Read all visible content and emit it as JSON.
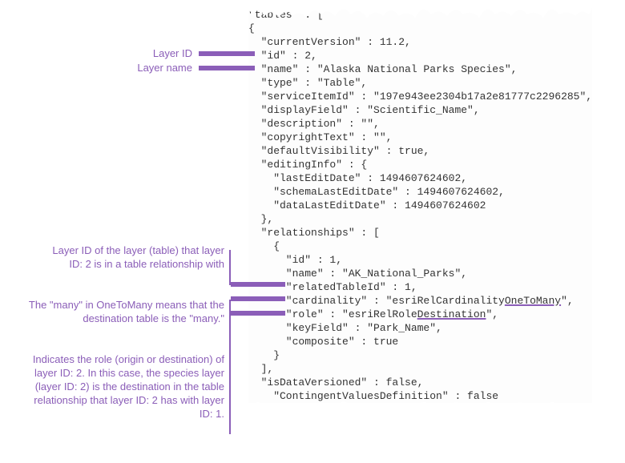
{
  "annotations": {
    "layerId": "Layer ID",
    "layerName": "Layer name",
    "relatedTable": "Layer ID of the layer (table) that layer ID: 2 is in a table relationship with",
    "onetomany": "The \"many\" in OneToMany means that the destination table is the \"many.\"",
    "role": "Indicates the role (origin or destination) of layer ID: 2. In this case, the species layer (layer ID: 2) is the destination in the table relationship that layer ID: 2 has with layer ID: 1."
  },
  "code": {
    "l1": "\"tables\" : [",
    "l2": "{",
    "l3": "  \"currentVersion\" : 11.2,",
    "l4": "  \"id\" : 2,",
    "l5": "  \"name\" : \"Alaska National Parks Species\",",
    "l6": "  \"type\" : \"Table\",",
    "l7": "  \"serviceItemId\" : \"197e943ee2304b17a2e81777c2296285\",",
    "l8": "  \"displayField\" : \"Scientific_Name\",",
    "l9": "  \"description\" : \"\",",
    "l10": "  \"copyrightText\" : \"\",",
    "l11": "  \"defaultVisibility\" : true,",
    "l12": "  \"editingInfo\" : {",
    "l13": "    \"lastEditDate\" : 1494607624602,",
    "l14": "    \"schemaLastEditDate\" : 1494607624602,",
    "l15": "    \"dataLastEditDate\" : 1494607624602",
    "l16": "  },",
    "l17": "  \"relationships\" : [",
    "l18": "    {",
    "l19": "      \"id\" : 1,",
    "l20": "      \"name\" : \"AK_National_Parks\",",
    "l21": "      \"relatedTableId\" : 1,",
    "l22a": "      \"cardinality\" : \"esriRelCardinality",
    "l22b": "OneToMany",
    "l22c": "\",",
    "l23a": "      \"role\" : \"esriRelRole",
    "l23b": "Destination",
    "l23c": "\",",
    "l24": "      \"keyField\" : \"Park_Name\",",
    "l25": "      \"composite\" : true",
    "l26": "    }",
    "l27": "  ],",
    "l28": "  \"isDataVersioned\" : false,",
    "l29": "    \"ContingentValuesDefinition\" : false"
  }
}
